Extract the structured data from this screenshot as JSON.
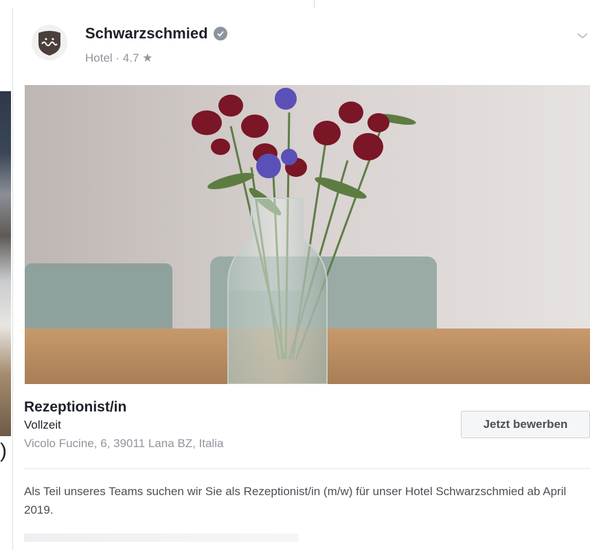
{
  "page": {
    "name": "Schwarzschmied",
    "category": "Hotel",
    "rating": "4.7",
    "separator": " · ",
    "star": "★"
  },
  "job": {
    "title": "Rezeptionist/in",
    "type": "Vollzeit",
    "address": "Vicolo Fucine, 6, 39011 Lana BZ, Italia",
    "apply_label": "Jetzt bewerben",
    "description": "Als Teil unseres Teams suchen wir Sie als Rezeptionist/in (m/w) für unser Hotel Schwarzschmied ab April 2019."
  },
  "colors": {
    "accent_text": "#1d2129",
    "muted_text": "#90949c",
    "button_bg": "#f5f6f7"
  },
  "icons": {
    "verified": "verified-badge-icon",
    "menu": "chevron-down-icon",
    "logo": "schwarzschmied-logo-icon"
  }
}
